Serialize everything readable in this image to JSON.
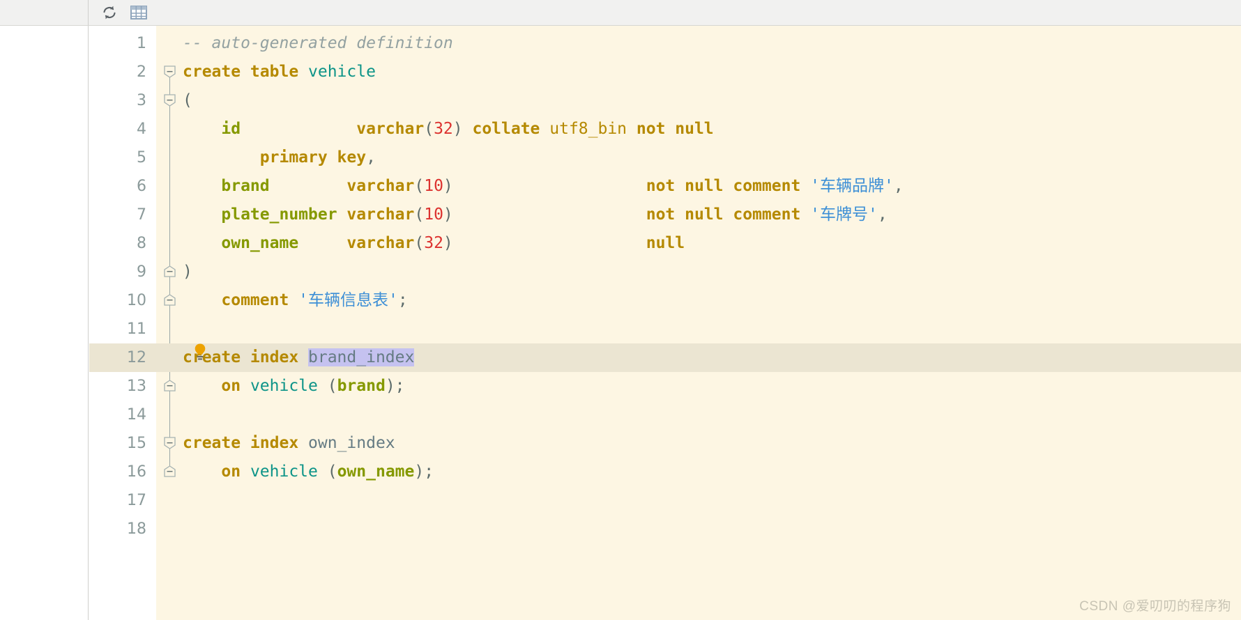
{
  "toolbar": {
    "buttons": [
      {
        "name": "refresh-icon",
        "label": "Refresh",
        "color": "#5a6166"
      },
      {
        "name": "table-grid-icon",
        "label": "Open Table Editor",
        "color": "#8fa5bc"
      }
    ]
  },
  "editor": {
    "background": "#fdf6e3",
    "current_line": 12,
    "gutter_background": "#ffffff",
    "current_line_background": "#ebe5d2",
    "selection_background": "#c5c2f0",
    "lines": [
      {
        "number": "1",
        "tokens": [
          {
            "t": "-- auto-generated definition",
            "c": "cmt"
          }
        ]
      },
      {
        "number": "2",
        "tokens": [
          {
            "t": "create table ",
            "c": "kw"
          },
          {
            "t": "vehicle",
            "c": "tbl"
          }
        ]
      },
      {
        "number": "3",
        "tokens": [
          {
            "t": "(",
            "c": "plain"
          }
        ]
      },
      {
        "number": "4",
        "tokens": [
          {
            "t": "    ",
            "c": "plain"
          },
          {
            "t": "id",
            "c": "col"
          },
          {
            "t": "            ",
            "c": "plain"
          },
          {
            "t": "varchar",
            "c": "kw"
          },
          {
            "t": "(",
            "c": "plain"
          },
          {
            "t": "32",
            "c": "num"
          },
          {
            "t": ") ",
            "c": "plain"
          },
          {
            "t": "collate ",
            "c": "kw"
          },
          {
            "t": "utf8_bin ",
            "c": "charset"
          },
          {
            "t": "not null",
            "c": "kw"
          }
        ]
      },
      {
        "number": "5",
        "tokens": [
          {
            "t": "        ",
            "c": "plain"
          },
          {
            "t": "primary key",
            "c": "kw"
          },
          {
            "t": ",",
            "c": "plain"
          }
        ]
      },
      {
        "number": "6",
        "tokens": [
          {
            "t": "    ",
            "c": "plain"
          },
          {
            "t": "brand",
            "c": "col"
          },
          {
            "t": "        ",
            "c": "plain"
          },
          {
            "t": "varchar",
            "c": "kw"
          },
          {
            "t": "(",
            "c": "plain"
          },
          {
            "t": "10",
            "c": "num"
          },
          {
            "t": ")",
            "c": "plain"
          },
          {
            "t": "                    ",
            "c": "plain"
          },
          {
            "t": "not null comment ",
            "c": "kw"
          },
          {
            "t": "'车辆品牌'",
            "c": "str"
          },
          {
            "t": ",",
            "c": "plain"
          }
        ]
      },
      {
        "number": "7",
        "tokens": [
          {
            "t": "    ",
            "c": "plain"
          },
          {
            "t": "plate_number",
            "c": "col"
          },
          {
            "t": " ",
            "c": "plain"
          },
          {
            "t": "varchar",
            "c": "kw"
          },
          {
            "t": "(",
            "c": "plain"
          },
          {
            "t": "10",
            "c": "num"
          },
          {
            "t": ")",
            "c": "plain"
          },
          {
            "t": "                    ",
            "c": "plain"
          },
          {
            "t": "not null comment ",
            "c": "kw"
          },
          {
            "t": "'车牌号'",
            "c": "str"
          },
          {
            "t": ",",
            "c": "plain"
          }
        ]
      },
      {
        "number": "8",
        "tokens": [
          {
            "t": "    ",
            "c": "plain"
          },
          {
            "t": "own_name",
            "c": "col"
          },
          {
            "t": "     ",
            "c": "plain"
          },
          {
            "t": "varchar",
            "c": "kw"
          },
          {
            "t": "(",
            "c": "plain"
          },
          {
            "t": "32",
            "c": "num"
          },
          {
            "t": ")",
            "c": "plain"
          },
          {
            "t": "                    ",
            "c": "plain"
          },
          {
            "t": "null",
            "c": "kw"
          }
        ]
      },
      {
        "number": "9",
        "tokens": [
          {
            "t": ")",
            "c": "plain"
          }
        ]
      },
      {
        "number": "10",
        "tokens": [
          {
            "t": "    ",
            "c": "plain"
          },
          {
            "t": "comment ",
            "c": "kw"
          },
          {
            "t": "'车辆信息表'",
            "c": "str"
          },
          {
            "t": ";",
            "c": "plain"
          }
        ]
      },
      {
        "number": "11",
        "tokens": []
      },
      {
        "number": "12",
        "tokens": [
          {
            "t": "create index ",
            "c": "kw"
          },
          {
            "t": "brand_index",
            "c": "ident sel"
          }
        ]
      },
      {
        "number": "13",
        "tokens": [
          {
            "t": "    ",
            "c": "plain"
          },
          {
            "t": "on ",
            "c": "kw"
          },
          {
            "t": "vehicle",
            "c": "tbl"
          },
          {
            "t": " (",
            "c": "plain"
          },
          {
            "t": "brand",
            "c": "col"
          },
          {
            "t": ");",
            "c": "plain"
          }
        ]
      },
      {
        "number": "14",
        "tokens": []
      },
      {
        "number": "15",
        "tokens": [
          {
            "t": "create index ",
            "c": "kw"
          },
          {
            "t": "own_index",
            "c": "ident"
          }
        ]
      },
      {
        "number": "16",
        "tokens": [
          {
            "t": "    ",
            "c": "plain"
          },
          {
            "t": "on ",
            "c": "kw"
          },
          {
            "t": "vehicle",
            "c": "tbl"
          },
          {
            "t": " (",
            "c": "plain"
          },
          {
            "t": "own_name",
            "c": "col"
          },
          {
            "t": ");",
            "c": "plain"
          }
        ]
      },
      {
        "number": "17",
        "tokens": []
      },
      {
        "number": "18",
        "tokens": []
      }
    ],
    "folds": [
      {
        "line": 2,
        "type": "start"
      },
      {
        "line": 3,
        "type": "start"
      },
      {
        "line": 9,
        "type": "end"
      },
      {
        "line": 10,
        "type": "end"
      },
      {
        "line": 12,
        "type": "start"
      },
      {
        "line": 13,
        "type": "end"
      },
      {
        "line": 15,
        "type": "start"
      },
      {
        "line": 16,
        "type": "end"
      }
    ],
    "intention_bulb": {
      "name": "intention-bulb-icon",
      "line": 11,
      "color": "#eda200"
    }
  },
  "watermark": {
    "text": "CSDN @爱叨叨的程序狗"
  }
}
